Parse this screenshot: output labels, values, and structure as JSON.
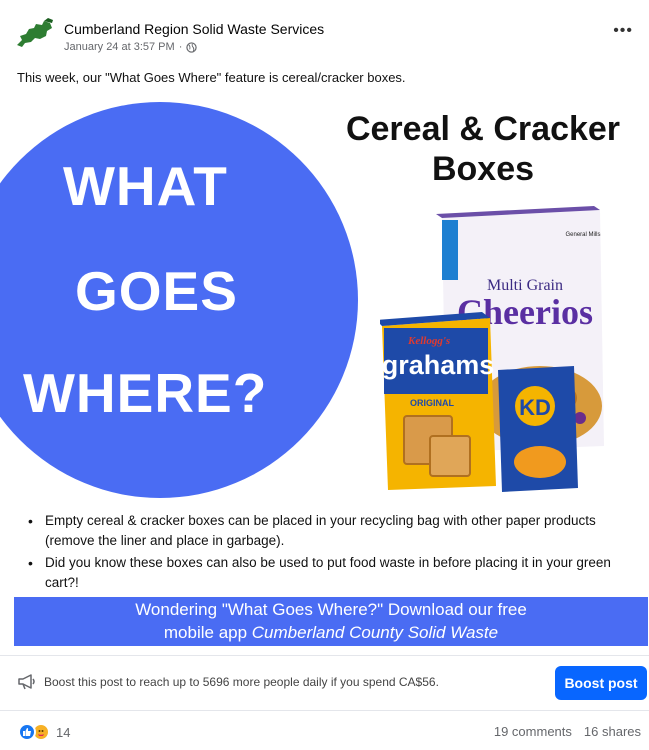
{
  "post": {
    "page_name": "Cumberland Region Solid Waste Services",
    "timestamp": "January 24 at 3:57 PM",
    "separator": "·",
    "audience_icon": "globe-icon",
    "more_icon": "more-options-icon",
    "caption": "This week, our \"What Goes Where\" feature is cereal/cracker boxes."
  },
  "image": {
    "circle_lines": [
      "WHAT",
      "GOES",
      "WHERE?"
    ],
    "headline_lines": [
      "Cereal & Cracker",
      "Boxes"
    ],
    "box_labels": {
      "cheerios_top": "Multi Grain",
      "cheerios": "Cheerios",
      "cheerios_brand": "General Mills",
      "grahams_brand": "Kellogg's",
      "grahams": "grahams",
      "grahams_sub": "ORIGINAL",
      "kd": "KD"
    },
    "bullets": [
      "Empty cereal & cracker boxes can be placed in your recycling bag with other paper products (remove the liner and place in garbage).",
      "Did you know these boxes can also be used to put food waste in before placing it in your green cart?!"
    ],
    "banner_line1": "Wondering \"What Goes Where?\" Download our free",
    "banner_line2_prefix": "mobile app ",
    "banner_app": "Cumberland County Solid Waste",
    "colors": {
      "blue": "#4a6cf3"
    }
  },
  "boost": {
    "icon": "megaphone-icon",
    "text": "Boost this post to reach up to 5696 more people daily if you spend CA$56.",
    "button": "Boost post"
  },
  "footer": {
    "reaction_icons": [
      "like-icon",
      "care-icon"
    ],
    "reaction_count": "14",
    "comments": "19 comments",
    "shares": "16 shares"
  }
}
